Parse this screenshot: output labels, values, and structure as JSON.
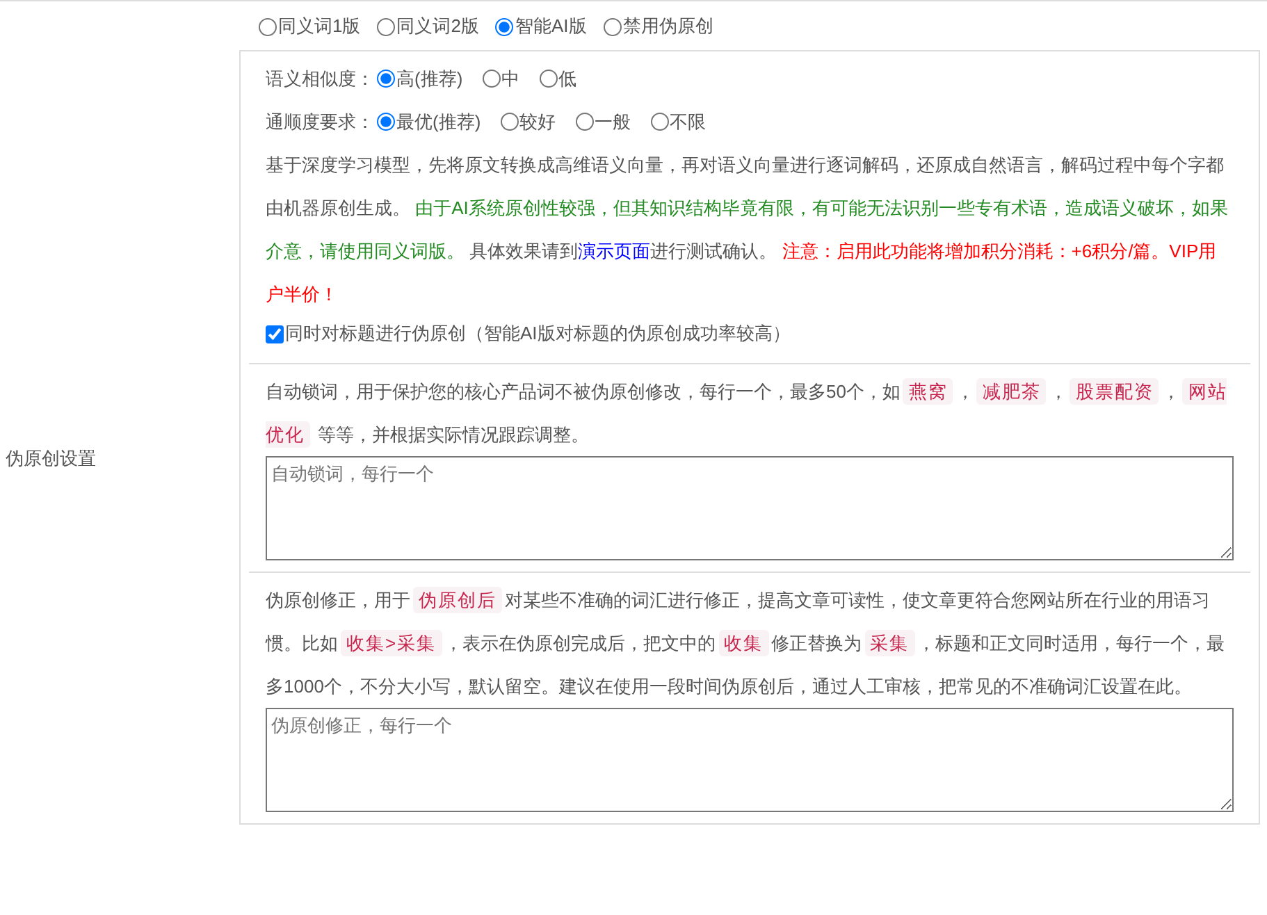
{
  "setting_label": "伪原创设置",
  "modes": [
    {
      "label": "同义词1版",
      "selected": false
    },
    {
      "label": "同义词2版",
      "selected": false
    },
    {
      "label": "智能AI版",
      "selected": true
    },
    {
      "label": "禁用伪原创",
      "selected": false
    }
  ],
  "similarity": {
    "label": "语义相似度：",
    "options": [
      {
        "label": "高(推荐)",
        "selected": true
      },
      {
        "label": "中",
        "selected": false
      },
      {
        "label": "低",
        "selected": false
      }
    ]
  },
  "fluency": {
    "label": "通顺度要求：",
    "options": [
      {
        "label": "最优(推荐)",
        "selected": true
      },
      {
        "label": "较好",
        "selected": false
      },
      {
        "label": "一般",
        "selected": false
      },
      {
        "label": "不限",
        "selected": false
      }
    ]
  },
  "ai_description": [
    {
      "kind": "text",
      "text": "基于深度学习模型，先将原文转换成高维语义向量，再对语义向量进行逐词解码，还原成自然语言，解码过程中每个字都由机器原创生成。 "
    },
    {
      "kind": "notice",
      "text": "由于AI系统原创性较强，但其知识结构毕竟有限，有可能无法识别一些专有术语，造成语义破坏，如果介意，请使用同义词版。"
    },
    {
      "kind": "text",
      "text": " 具体效果请到"
    },
    {
      "kind": "link",
      "text": "演示页面"
    },
    {
      "kind": "text",
      "text": "进行测试确认。 "
    },
    {
      "kind": "warning",
      "text": "注意：启用此功能将增加积分消耗：+6积分/篇。VIP用户半价！"
    }
  ],
  "title_option": {
    "label": "同时对标题进行伪原创（智能AI版对标题的伪原创成功率较高）",
    "checked": true
  },
  "lock_words": {
    "description": [
      {
        "kind": "text",
        "text": "自动锁词，用于保护您的核心产品词不被伪原创修改，每行一个，最多50个，如"
      },
      {
        "kind": "tag",
        "text": "燕窝"
      },
      {
        "kind": "text",
        "text": "，"
      },
      {
        "kind": "tag",
        "text": "减肥茶"
      },
      {
        "kind": "text",
        "text": "，"
      },
      {
        "kind": "tag",
        "text": "股票配资"
      },
      {
        "kind": "text",
        "text": "，"
      },
      {
        "kind": "tag",
        "text": "网站优化"
      },
      {
        "kind": "text",
        "text": " 等等，并根据实际情况跟踪调整。"
      }
    ],
    "placeholder": "自动锁词，每行一个"
  },
  "corrections": {
    "description": [
      {
        "kind": "text",
        "text": "伪原创修正，用于"
      },
      {
        "kind": "tag",
        "text": "伪原创后"
      },
      {
        "kind": "text",
        "text": "对某些不准确的词汇进行修正，提高文章可读性，使文章更符合您网站所在行业的用语习惯。比如"
      },
      {
        "kind": "tag",
        "text": "收集>采集"
      },
      {
        "kind": "text",
        "text": "，表示在伪原创完成后，把文中的"
      },
      {
        "kind": "tag",
        "text": "收集"
      },
      {
        "kind": "text",
        "text": "修正替换为"
      },
      {
        "kind": "tag",
        "text": "采集"
      },
      {
        "kind": "text",
        "text": "，标题和正文同时适用，每行一个，最多1000个，不分大小写，默认留空。建议在使用一段时间伪原创后，通过人工审核，把常见的不准确词汇设置在此。"
      }
    ],
    "placeholder": "伪原创修正，每行一个"
  }
}
